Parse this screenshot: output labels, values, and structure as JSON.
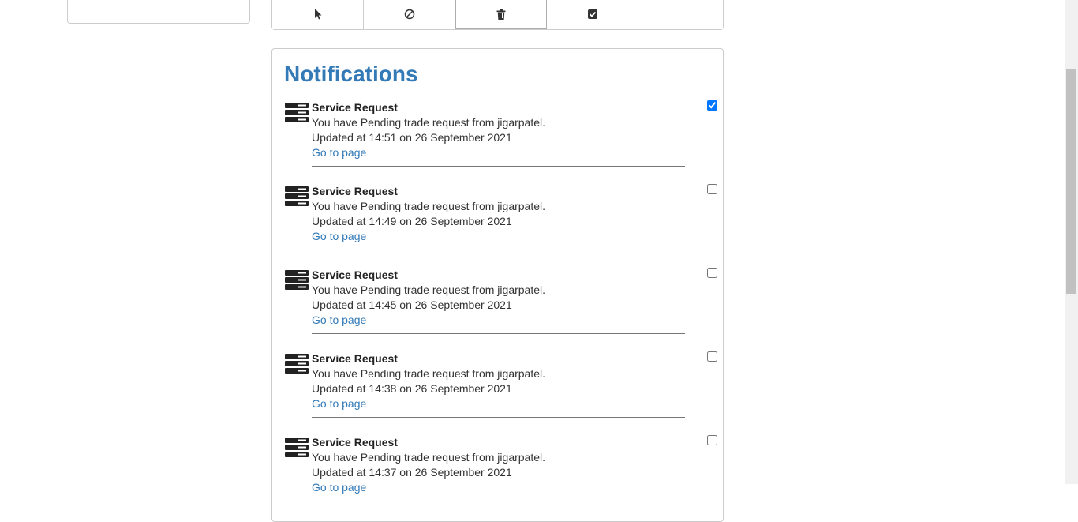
{
  "toolbar": {
    "buttons": [
      {
        "icon": "pointer-icon"
      },
      {
        "icon": "ban-icon"
      },
      {
        "icon": "trash-icon"
      },
      {
        "icon": "check-square-icon"
      },
      {
        "icon": ""
      }
    ]
  },
  "notifications": {
    "title": "Notifications",
    "items": [
      {
        "title": "Service Request",
        "message": "You have Pending trade request from jigarpatel.",
        "updated": "Updated at 14:51 on 26 September 2021",
        "link": "Go to page",
        "checked": true
      },
      {
        "title": "Service Request",
        "message": "You have Pending trade request from jigarpatel.",
        "updated": "Updated at 14:49 on 26 September 2021",
        "link": "Go to page",
        "checked": false
      },
      {
        "title": "Service Request",
        "message": "You have Pending trade request from jigarpatel.",
        "updated": "Updated at 14:45 on 26 September 2021",
        "link": "Go to page",
        "checked": false
      },
      {
        "title": "Service Request",
        "message": "You have Pending trade request from jigarpatel.",
        "updated": "Updated at 14:38 on 26 September 2021",
        "link": "Go to page",
        "checked": false
      },
      {
        "title": "Service Request",
        "message": "You have Pending trade request from jigarpatel.",
        "updated": "Updated at 14:37 on 26 September 2021",
        "link": "Go to page",
        "checked": false
      }
    ]
  },
  "colors": {
    "accent": "#337ab7",
    "text": "#333333",
    "border": "#cccccc"
  }
}
